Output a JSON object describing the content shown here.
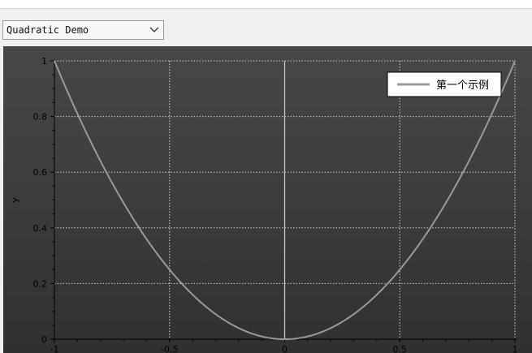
{
  "toolbar": {
    "dropdown_value": "Quadratic Demo",
    "dropdown_icon": "chevron-down-icon"
  },
  "chart_data": {
    "type": "line",
    "title": "",
    "xlabel": "",
    "ylabel": "y",
    "xlim": [
      -1,
      1
    ],
    "ylim": [
      0,
      1
    ],
    "grid": true,
    "legend_position": "top-right",
    "x_ticks": [
      "-1",
      "-0.5",
      "0",
      "0.5",
      "1"
    ],
    "y_ticks": [
      "0",
      "0.2",
      "0.4",
      "0.6",
      "0.8",
      "1"
    ],
    "series": [
      {
        "name": "第一个示例",
        "color": "#9a9a9a",
        "x": [
          -1,
          -0.9,
          -0.8,
          -0.7,
          -0.6,
          -0.5,
          -0.4,
          -0.3,
          -0.2,
          -0.1,
          0,
          0.1,
          0.2,
          0.3,
          0.4,
          0.5,
          0.6,
          0.7,
          0.8,
          0.9,
          1
        ],
        "y": [
          1,
          0.81,
          0.64,
          0.49,
          0.36,
          0.25,
          0.16,
          0.09,
          0.04,
          0.01,
          0,
          0.01,
          0.04,
          0.09,
          0.16,
          0.25,
          0.36,
          0.49,
          0.64,
          0.81,
          1
        ]
      }
    ],
    "colors": {
      "background_top": "#474747",
      "background_bottom": "#303030",
      "axis": "#000000",
      "grid": "#d0d0d0",
      "zero_line": "#c8c8c8",
      "legend_bg": "#ffffff"
    }
  }
}
